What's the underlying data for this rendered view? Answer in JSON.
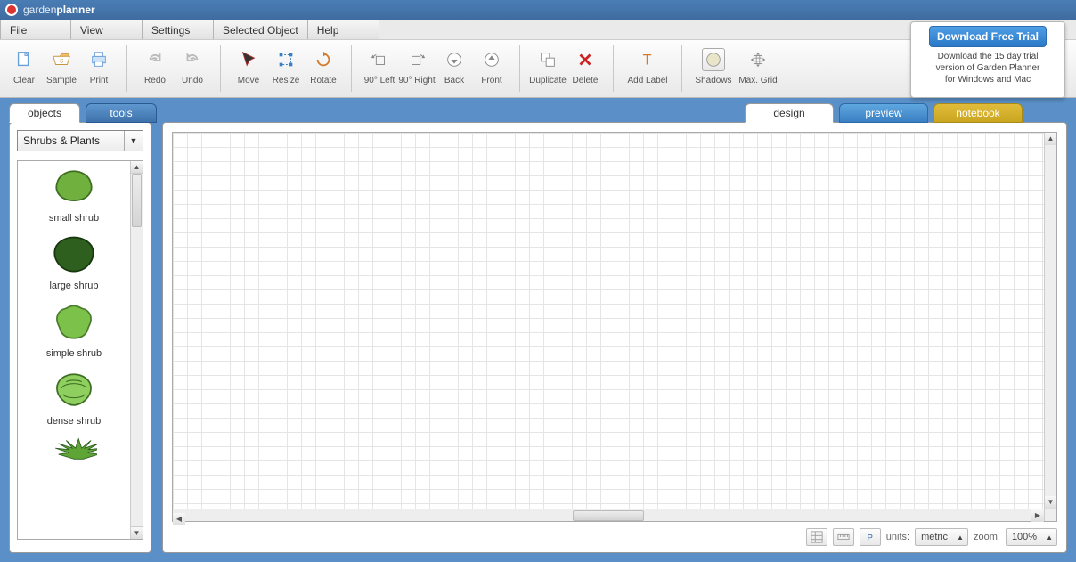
{
  "app": {
    "brand_light": "garden",
    "brand_bold": "planner"
  },
  "trial": {
    "button": "Download Free Trial",
    "line1": "Download the 15 day trial",
    "line2": "version of Garden Planner",
    "line3": "for Windows and Mac"
  },
  "menu": {
    "file": "File",
    "view": "View",
    "settings": "Settings",
    "selected_object": "Selected Object",
    "help": "Help"
  },
  "toolbar": {
    "clear": "Clear",
    "sample": "Sample",
    "print": "Print",
    "redo": "Redo",
    "undo": "Undo",
    "move": "Move",
    "resize": "Resize",
    "rotate": "Rotate",
    "left90": "90° Left",
    "right90": "90° Right",
    "back": "Back",
    "front": "Front",
    "duplicate": "Duplicate",
    "delete": "Delete",
    "add_label": "Add Label",
    "shadows": "Shadows",
    "max_grid": "Max. Grid"
  },
  "left_tabs": {
    "objects": "objects",
    "tools": "tools"
  },
  "category": {
    "selected": "Shrubs & Plants"
  },
  "objects": [
    {
      "label": "small shrub"
    },
    {
      "label": "large shrub"
    },
    {
      "label": "simple shrub"
    },
    {
      "label": "dense shrub"
    }
  ],
  "right_tabs": {
    "design": "design",
    "preview": "preview",
    "notebook": "notebook"
  },
  "status": {
    "units_label": "units:",
    "units_value": "metric",
    "zoom_label": "zoom:",
    "zoom_value": "100%"
  }
}
